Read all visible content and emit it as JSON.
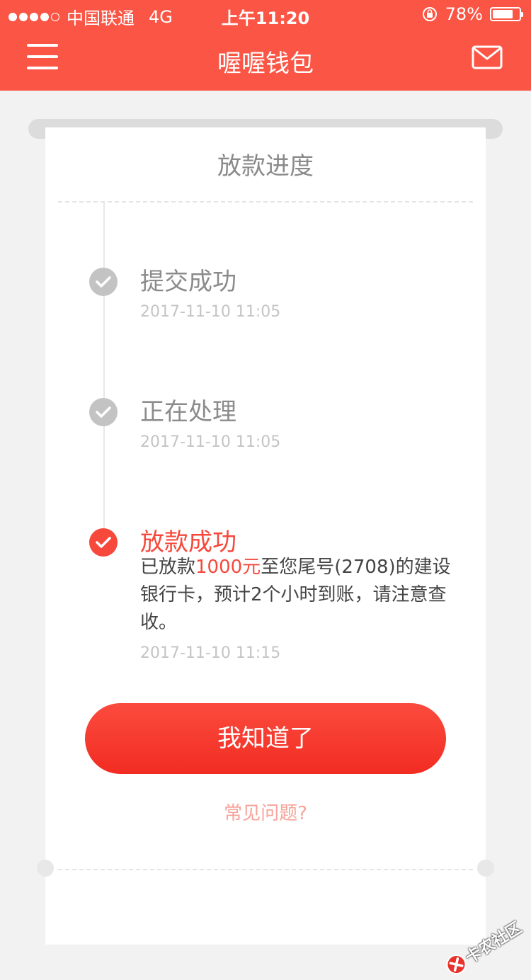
{
  "status_bar": {
    "carrier": "中国联通",
    "network": "4G",
    "time": "上午11:20",
    "battery": "78%",
    "battery_level": 0.78
  },
  "navbar": {
    "title": "喔喔钱包",
    "left_icon": "menu-icon",
    "right_icon": "mail-icon"
  },
  "card": {
    "title": "放款进度",
    "steps": [
      {
        "label": "提交成功",
        "time": "2017-11-10 11:05"
      },
      {
        "label": "正在处理",
        "time": "2017-11-10 11:05"
      },
      {
        "label": "放款成功",
        "desc_prefix": "已放款",
        "amount": "1000元",
        "desc_suffix": "至您尾号(2708)的建设银行卡，预计2个小时到账，请注意查收。",
        "time": "2017-11-10 11:15"
      }
    ],
    "button_label": "我知道了",
    "faq_link": "常见问题?"
  },
  "watermark": "卡农社区",
  "colors": {
    "primary": "#fb5545",
    "active_step": "#f6483b",
    "inactive_step": "#c3c3c3",
    "faq": "#f7a39a"
  }
}
